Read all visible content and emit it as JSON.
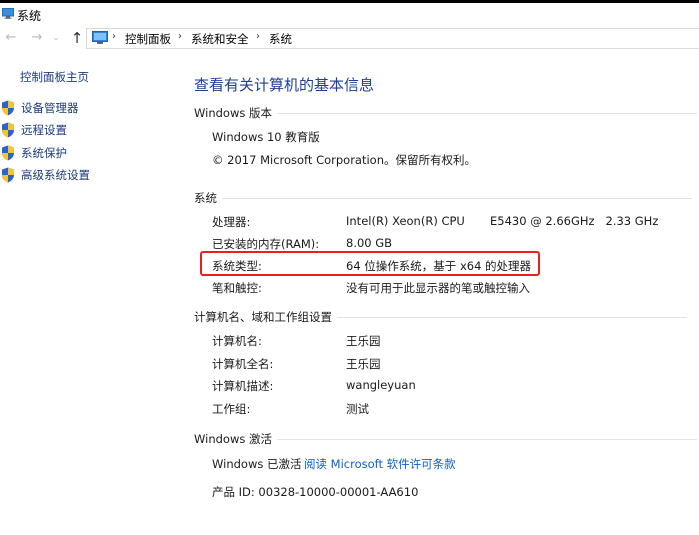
{
  "window": {
    "title": "系统"
  },
  "breadcrumb": {
    "items": [
      "控制面板",
      "系统和安全",
      "系统"
    ],
    "separator": "›"
  },
  "sidebar": {
    "home_label": "控制面板主页",
    "items": [
      {
        "label": "设备管理器",
        "icon": "shield-icon"
      },
      {
        "label": "远程设置",
        "icon": "shield-icon"
      },
      {
        "label": "系统保护",
        "icon": "shield-icon"
      },
      {
        "label": "高级系统设置",
        "icon": "shield-icon"
      }
    ]
  },
  "main": {
    "title": "查看有关计算机的基本信息",
    "edition": {
      "heading": "Windows 版本",
      "name": "Windows 10 教育版",
      "copyright": "© 2017 Microsoft Corporation。保留所有权利。"
    },
    "system": {
      "heading": "系统",
      "processor_label": "处理器:",
      "processor_value": "Intel(R) Xeon(R) CPU",
      "processor_model": "E5430 @ 2.66GHz   2.33 GHz",
      "ram_label": "已安装的内存(RAM):",
      "ram_value": "8.00 GB",
      "type_label": "系统类型:",
      "type_value": "64 位操作系统，基于 x64 的处理器",
      "pen_label": "笔和触控:",
      "pen_value": "没有可用于此显示器的笔或触控输入"
    },
    "computer": {
      "heading": "计算机名、域和工作组设置",
      "name_label": "计算机名:",
      "name_value": "王乐园",
      "fullname_label": "计算机全名:",
      "fullname_value": "王乐园",
      "desc_label": "计算机描述:",
      "desc_value": "wangleyuan",
      "workgroup_label": "工作组:",
      "workgroup_value": "测试"
    },
    "activation": {
      "heading": "Windows 激活",
      "status": "Windows 已激活",
      "license_link": "阅读 Microsoft 软件许可条款",
      "product_id": "产品 ID: 00328-10000-00001-AA610"
    }
  },
  "colors": {
    "accent": "#1e3e95",
    "link": "#0a63cc",
    "highlight_border": "#e8201f"
  }
}
